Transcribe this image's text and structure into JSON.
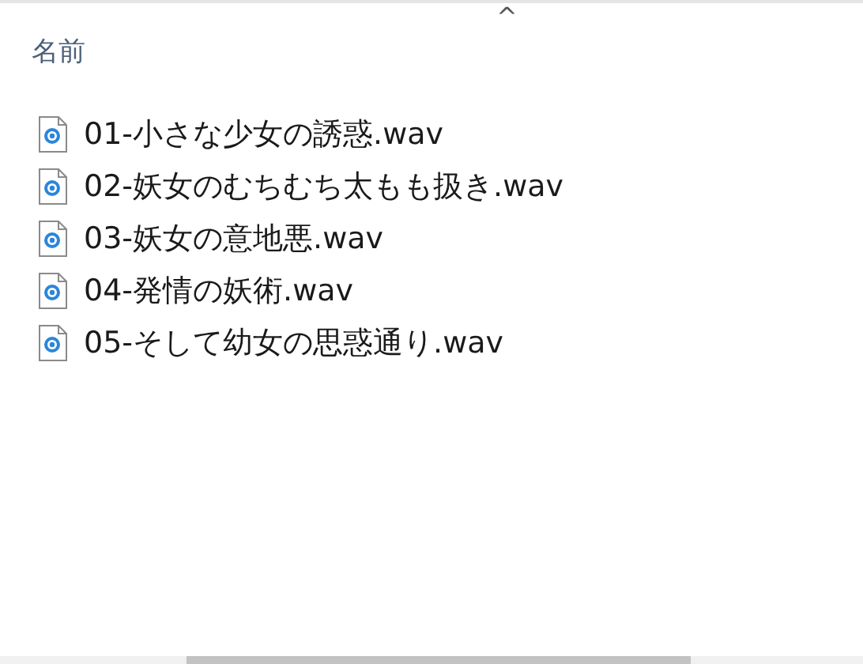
{
  "column_header": {
    "label": "名前",
    "sort_caret": "^"
  },
  "files": [
    {
      "name": "01-小さな少女の誘惑.wav"
    },
    {
      "name": "02-妖女のむちむち太もも扱き.wav"
    },
    {
      "name": "03-妖女の意地悪.wav"
    },
    {
      "name": "04-発情の妖術.wav"
    },
    {
      "name": "05-そして幼女の思惑通り.wav"
    }
  ]
}
